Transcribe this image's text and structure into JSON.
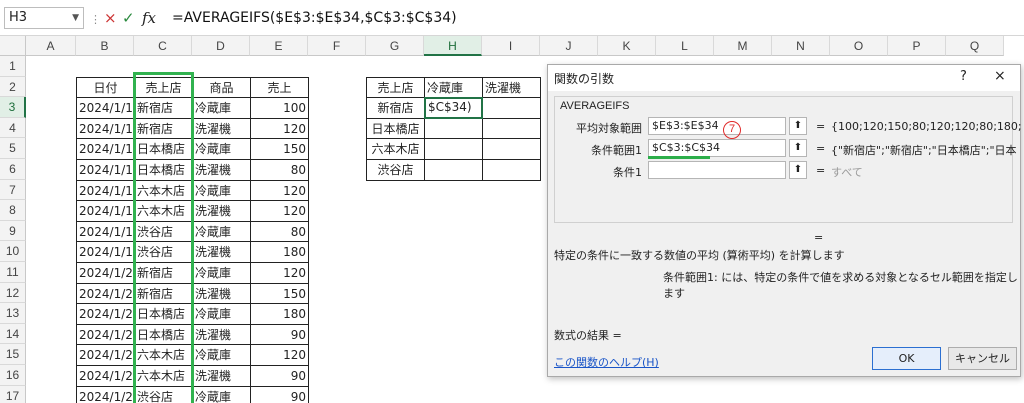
{
  "formula_bar": {
    "name_box": "H3",
    "cancel_icon": "×",
    "enter_icon": "✓",
    "fx_label": "fx",
    "formula": "=AVERAGEIFS($E$3:$E$34,$C$3:$C$34)"
  },
  "columns": [
    "A",
    "B",
    "C",
    "D",
    "E",
    "F",
    "G",
    "H",
    "I",
    "J",
    "K",
    "L",
    "M",
    "N",
    "O",
    "P",
    "Q"
  ],
  "rows": [
    "1",
    "2",
    "3",
    "4",
    "5",
    "6",
    "7",
    "8",
    "9",
    "10",
    "11",
    "12",
    "13",
    "14",
    "15",
    "16",
    "17"
  ],
  "table1": {
    "headers": [
      "日付",
      "売上店",
      "商品",
      "売上"
    ],
    "rows": [
      [
        "2024/1/1",
        "新宿店",
        "冷蔵庫",
        "100"
      ],
      [
        "2024/1/1",
        "新宿店",
        "洗濯機",
        "120"
      ],
      [
        "2024/1/1",
        "日本橋店",
        "冷蔵庫",
        "150"
      ],
      [
        "2024/1/1",
        "日本橋店",
        "洗濯機",
        "80"
      ],
      [
        "2024/1/1",
        "六本木店",
        "冷蔵庫",
        "120"
      ],
      [
        "2024/1/1",
        "六本木店",
        "洗濯機",
        "120"
      ],
      [
        "2024/1/1",
        "渋谷店",
        "冷蔵庫",
        "80"
      ],
      [
        "2024/1/1",
        "渋谷店",
        "洗濯機",
        "180"
      ],
      [
        "2024/1/2",
        "新宿店",
        "冷蔵庫",
        "120"
      ],
      [
        "2024/1/2",
        "新宿店",
        "洗濯機",
        "150"
      ],
      [
        "2024/1/2",
        "日本橋店",
        "冷蔵庫",
        "180"
      ],
      [
        "2024/1/2",
        "日本橋店",
        "洗濯機",
        "90"
      ],
      [
        "2024/1/2",
        "六本木店",
        "冷蔵庫",
        "120"
      ],
      [
        "2024/1/2",
        "六本木店",
        "洗濯機",
        "90"
      ],
      [
        "2024/1/2",
        "渋谷店",
        "冷蔵庫",
        "90"
      ]
    ]
  },
  "table2": {
    "headers": [
      "売上店",
      "冷蔵庫",
      "洗濯機"
    ],
    "stores": [
      "新宿店",
      "日本橋店",
      "六本木店",
      "渋谷店"
    ],
    "active_value": "$C$34)"
  },
  "dialog": {
    "title": "関数の引数",
    "help": "?",
    "close": "×",
    "function_name": "AVERAGEIFS",
    "args": [
      {
        "label": "平均対象範囲",
        "value": "$E$3:$E$34",
        "result": "{100;120;150;80;120;120;80;180;"
      },
      {
        "label": "条件範囲1",
        "value": "$C$3:$C$34",
        "result": "{\"新宿店\";\"新宿店\";\"日本橋店\";\"日本"
      },
      {
        "label": "条件1",
        "value": "",
        "result": "すべて"
      }
    ],
    "ref_button": "⬆",
    "equals": "=",
    "step_marker": "7",
    "description": "特定の条件に一致する数値の平均 (算術平均) を計算します",
    "arg_description": "条件範囲1:  には、特定の条件で値を求める対象となるセル範囲を指定します",
    "result_label": "数式の結果 =",
    "help_link": "この関数のヘルプ(H)",
    "ok": "OK",
    "cancel": "キャンセル"
  },
  "colors": {
    "accent": "#217346",
    "highlight": "#31b24f",
    "marker": "#e02a2a"
  }
}
